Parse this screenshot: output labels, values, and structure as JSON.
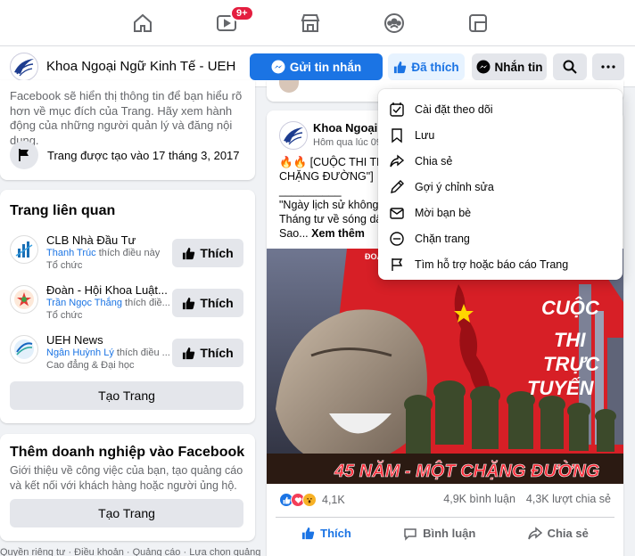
{
  "topnav": {
    "tabs": [
      {
        "name": "home",
        "icon": "home-icon"
      },
      {
        "name": "watch",
        "icon": "watch-icon",
        "badge": "9+"
      },
      {
        "name": "marketplace",
        "icon": "marketplace-icon"
      },
      {
        "name": "groups",
        "icon": "groups-icon"
      },
      {
        "name": "gaming",
        "icon": "gaming-icon"
      }
    ]
  },
  "pagebar": {
    "page_name": "Khoa Ngoại Ngữ Kinh Tế - UEH",
    "send_message_label": "Gửi tin nhắn",
    "liked_label": "Đã thích",
    "messenger_label": "Nhắn tin"
  },
  "about": {
    "transparency_text": "Facebook sẽ hiển thị thông tin để bạn hiểu rõ hơn về mục đích của Trang. Hãy xem hành động của những người quản lý và đăng nội dung.",
    "created_text": "Trang được tạo vào 17 tháng 3, 2017"
  },
  "related": {
    "title": "Trang liên quan",
    "items": [
      {
        "name": "CLB Nhà Đầu Tư",
        "liker": "Thanh Trúc",
        "liker_suffix": " thích điều này",
        "category": "Tổ chức",
        "like_label": "Thích"
      },
      {
        "name": "Đoàn - Hội Khoa Luật...",
        "liker": "Trần Ngọc Thắng",
        "liker_suffix": " thích điề...",
        "category": "Tổ chức",
        "like_label": "Thích"
      },
      {
        "name": "UEH News",
        "liker": "Ngân Huỳnh Lý",
        "liker_suffix": " thích điều ...",
        "category": "Cao đẳng & Đại học",
        "like_label": "Thích"
      }
    ],
    "create_page_label": "Tạo Trang"
  },
  "business": {
    "title": "Thêm doanh nghiệp vào Facebook",
    "desc": "Giới thiệu về công việc của bạn, tạo quảng cáo và kết nối với khách hàng hoặc người ủng hộ.",
    "create_page_label": "Tạo Trang"
  },
  "footer": {
    "links": "Quyền riêng tư · Điều khoản · Quảng cáo · Lựa chọn quảng"
  },
  "post": {
    "author": "Khoa Ngoại N",
    "time": "Hôm qua lúc 09",
    "line1": "🔥🔥 [CUỘC THI TRẮ",
    "line2": "CHẶNG ĐƯỜNG\"] 🔥",
    "line3": "__________",
    "line4": "\"Ngày lịch sử không c",
    "line5": "Tháng tư về sóng dậy",
    "line6_prefix": "Sao...",
    "see_more": "Xem thêm",
    "image_text": {
      "title_line1": "CUỘC",
      "title_line2": "THI",
      "title_line3": "TRỰC",
      "title_line4": "TUYẾN",
      "banner": "45 NĂM - MỘT CHẶNG ĐƯỜNG",
      "corner": "ĐOÀ BAN"
    },
    "reaction_count": "4,1K",
    "comments": "4,9K bình luận",
    "shares": "4,3K lượt chia sẻ",
    "like_label": "Thích",
    "comment_label": "Bình luận",
    "share_label": "Chia sẻ"
  },
  "menu": {
    "items": [
      {
        "label": "Cài đặt theo dõi",
        "icon": "follow-settings-icon"
      },
      {
        "label": "Lưu",
        "icon": "bookmark-icon"
      },
      {
        "label": "Chia sẻ",
        "icon": "share-icon"
      },
      {
        "label": "Gợi ý chỉnh sửa",
        "icon": "pencil-icon"
      },
      {
        "label": "Mời bạn bè",
        "icon": "invite-icon"
      },
      {
        "label": "Chặn trang",
        "icon": "block-icon"
      },
      {
        "label": "Tìm hỗ trợ hoặc báo cáo Trang",
        "icon": "report-flag-icon"
      }
    ]
  },
  "colors": {
    "brand_blue": "#1b74e4",
    "badge_red": "#e41e3f",
    "poster_red": "#d71f26"
  }
}
